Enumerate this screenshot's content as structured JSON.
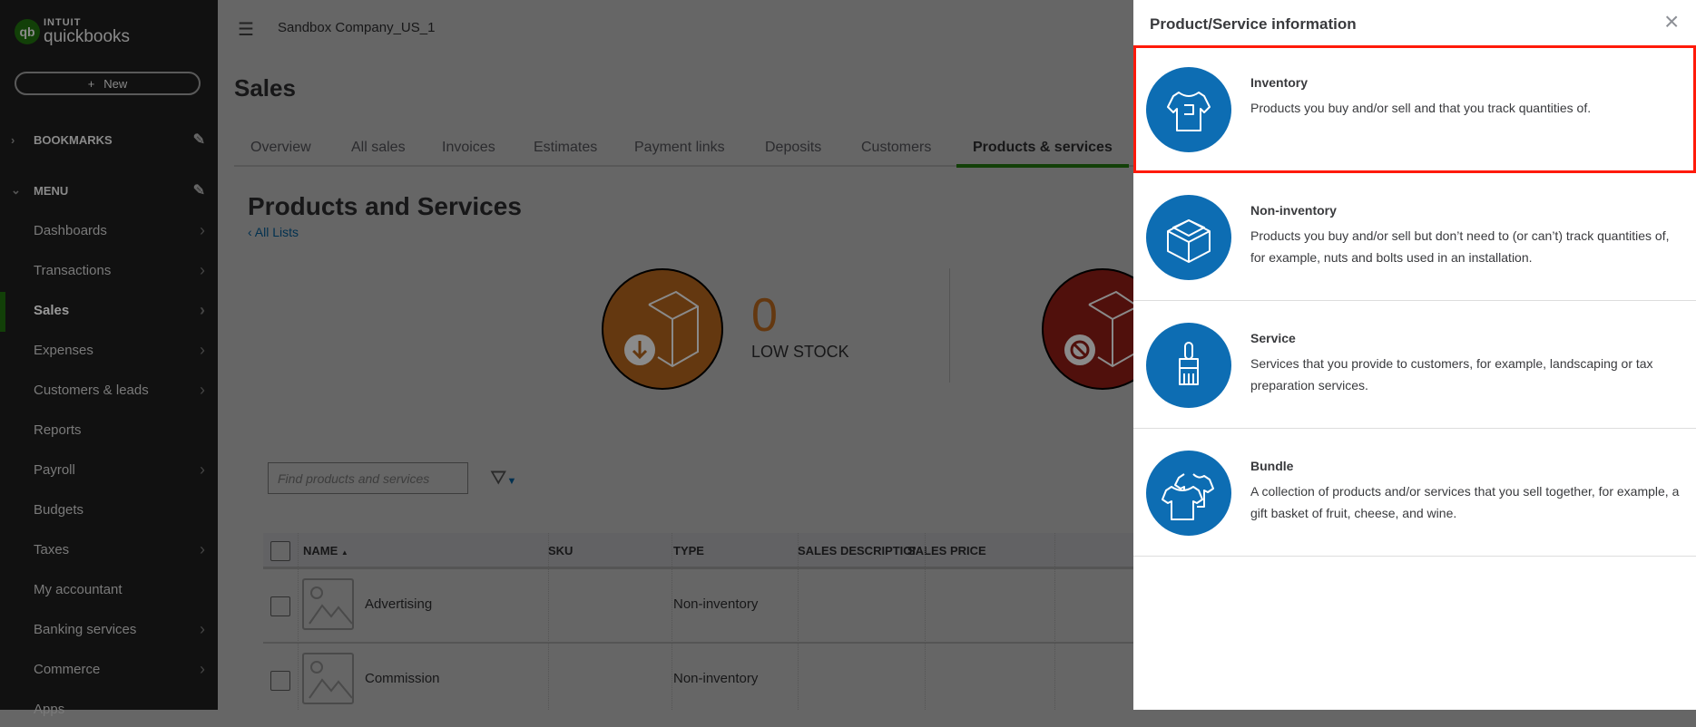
{
  "sidebar": {
    "logo": {
      "brand_top": "INTUIT",
      "brand_bottom": "quickbooks",
      "mark": "qb"
    },
    "new_label": "New",
    "bookmarks_label": "BOOKMARKS",
    "menu_label": "MENU",
    "items": [
      {
        "label": "Dashboards",
        "arrow": true
      },
      {
        "label": "Transactions",
        "arrow": true
      },
      {
        "label": "Sales",
        "arrow": true,
        "active": true
      },
      {
        "label": "Expenses",
        "arrow": true
      },
      {
        "label": "Customers & leads",
        "arrow": true
      },
      {
        "label": "Reports",
        "arrow": false
      },
      {
        "label": "Payroll",
        "arrow": true
      },
      {
        "label": "Budgets",
        "arrow": false
      },
      {
        "label": "Taxes",
        "arrow": true
      },
      {
        "label": "My accountant",
        "arrow": false
      },
      {
        "label": "Banking services",
        "arrow": true
      },
      {
        "label": "Commerce",
        "arrow": true
      },
      {
        "label": "Apps",
        "arrow": false
      }
    ]
  },
  "header": {
    "company": "Sandbox Company_US_1"
  },
  "page": {
    "title": "Sales",
    "tabs": [
      "Overview",
      "All sales",
      "Invoices",
      "Estimates",
      "Payment links",
      "Deposits",
      "Customers",
      "Products & services"
    ],
    "active_tab": "Products & services",
    "section_title": "Products and Services",
    "all_lists": "All Lists",
    "low_stock": {
      "count": "0",
      "label": "LOW STOCK"
    },
    "search_placeholder": "Find products and services",
    "table": {
      "columns": [
        "NAME",
        "SKU",
        "TYPE",
        "SALES DESCRIPTION",
        "SALES PRICE"
      ],
      "sort_indicator": "▲",
      "rows": [
        {
          "name": "Advertising",
          "sku": "",
          "type": "Non-inventory"
        },
        {
          "name": "Commission",
          "sku": "",
          "type": "Non-inventory"
        }
      ]
    }
  },
  "panel": {
    "title": "Product/Service information",
    "close_icon": "×",
    "options": [
      {
        "title": "Inventory",
        "desc": "Products you buy and/or sell and that you track quantities of.",
        "icon": "shirt-tag-icon",
        "highlighted": true
      },
      {
        "title": "Non-inventory",
        "desc": "Products you buy and/or sell but don’t need to (or can’t) track quantities of, for example, nuts and bolts used in an installation.",
        "icon": "open-box-icon"
      },
      {
        "title": "Service",
        "desc": "Services that you provide to customers, for example, landscaping or tax preparation services.",
        "icon": "paintbrush-icon"
      },
      {
        "title": "Bundle",
        "desc": "A collection of products and/or services that you sell together, for example, a gift basket of fruit, cheese, and wine.",
        "icon": "two-shirts-icon"
      }
    ]
  },
  "colors": {
    "accent_green": "#2ca01c",
    "icon_blue": "#0d6db3",
    "highlight_red": "#ff1a0a",
    "low_stock_orange": "#f98d1c",
    "out_of_stock_red": "#c9221f"
  }
}
